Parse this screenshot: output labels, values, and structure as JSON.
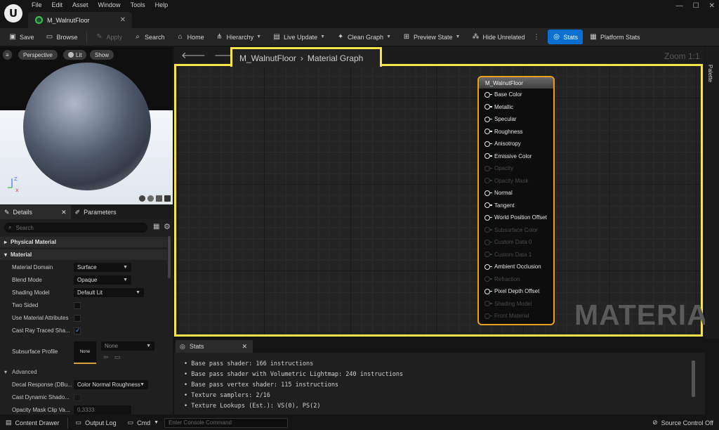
{
  "menu": [
    "File",
    "Edit",
    "Asset",
    "Window",
    "Tools",
    "Help"
  ],
  "document_tab": {
    "title": "M_WalnutFloor"
  },
  "toolbar": {
    "save": "Save",
    "browse": "Browse",
    "apply": "Apply",
    "search": "Search",
    "home": "Home",
    "hierarchy": "Hierarchy",
    "live_update": "Live Update",
    "clean_graph": "Clean Graph",
    "preview_state": "Preview State",
    "hide_unrelated": "Hide Unrelated",
    "stats": "Stats",
    "platform_stats": "Platform Stats"
  },
  "viewport": {
    "perspective": "Perspective",
    "lit": "Lit",
    "show": "Show"
  },
  "details": {
    "tab_details": "Details",
    "tab_parameters": "Parameters",
    "search_placeholder": "Search",
    "section_physical": "Physical Material",
    "section_material": "Material",
    "rows": [
      {
        "label": "Material Domain",
        "value": "Surface"
      },
      {
        "label": "Blend Mode",
        "value": "Opaque"
      },
      {
        "label": "Shading Model",
        "value": "Default Lit"
      },
      {
        "label": "Two Sided",
        "checked": false
      },
      {
        "label": "Use Material Attributes",
        "checked": false
      },
      {
        "label": "Cast Ray Traced Sha...",
        "checked": true
      }
    ],
    "subsurface_label": "Subsurface Profile",
    "subsurface_thumb": "None",
    "subsurface_value": "None",
    "advanced": "Advanced",
    "decal_label": "Decal Response (DBu...",
    "decal_value": "Color Normal Roughness",
    "cast_dyn_label": "Cast Dynamic Shado...",
    "opacity_clip_label": "Opacity Mask Clip Va...",
    "opacity_clip_value": "0.3333"
  },
  "graph": {
    "breadcrumb_asset": "M_WalnutFloor",
    "breadcrumb_graph": "Material Graph",
    "zoom": "Zoom 1:1",
    "watermark": "MATERIAL",
    "palette": "Palette",
    "node_title": "M_WalnutFloor",
    "pins": [
      {
        "label": "Base Color",
        "enabled": true
      },
      {
        "label": "Metallic",
        "enabled": true
      },
      {
        "label": "Specular",
        "enabled": true
      },
      {
        "label": "Roughness",
        "enabled": true
      },
      {
        "label": "Anisotropy",
        "enabled": true
      },
      {
        "label": "Emissive Color",
        "enabled": true
      },
      {
        "label": "Opacity",
        "enabled": false
      },
      {
        "label": "Opacity Mask",
        "enabled": false
      },
      {
        "label": "Normal",
        "enabled": true
      },
      {
        "label": "Tangent",
        "enabled": true
      },
      {
        "label": "World Position Offset",
        "enabled": true
      },
      {
        "label": "Subsurface Color",
        "enabled": false
      },
      {
        "label": "Custom Data 0",
        "enabled": false
      },
      {
        "label": "Custom Data 1",
        "enabled": false
      },
      {
        "label": "Ambient Occlusion",
        "enabled": true
      },
      {
        "label": "Refraction",
        "enabled": false
      },
      {
        "label": "Pixel Depth Offset",
        "enabled": true
      },
      {
        "label": "Shading Model",
        "enabled": false
      },
      {
        "label": "Front Material",
        "enabled": false
      }
    ]
  },
  "stats": {
    "tab": "Stats",
    "lines": [
      "• Base pass shader: 166 instructions",
      "• Base pass shader with Volumetric Lightmap: 240 instructions",
      "• Base pass vertex shader: 115 instructions",
      "• Texture samplers: 2/16",
      "• Texture Lookups (Est.): VS(0), PS(2)"
    ]
  },
  "statusbar": {
    "content_drawer": "Content Drawer",
    "output_log": "Output Log",
    "cmd": "Cmd",
    "console_placeholder": "Enter Console Command",
    "source_control": "Source Control Off"
  },
  "colors": {
    "highlight": "#f5e54a",
    "node_border": "#e9a11b",
    "stats_active": "#0b6fd2",
    "material_green": "#3dbf59"
  }
}
